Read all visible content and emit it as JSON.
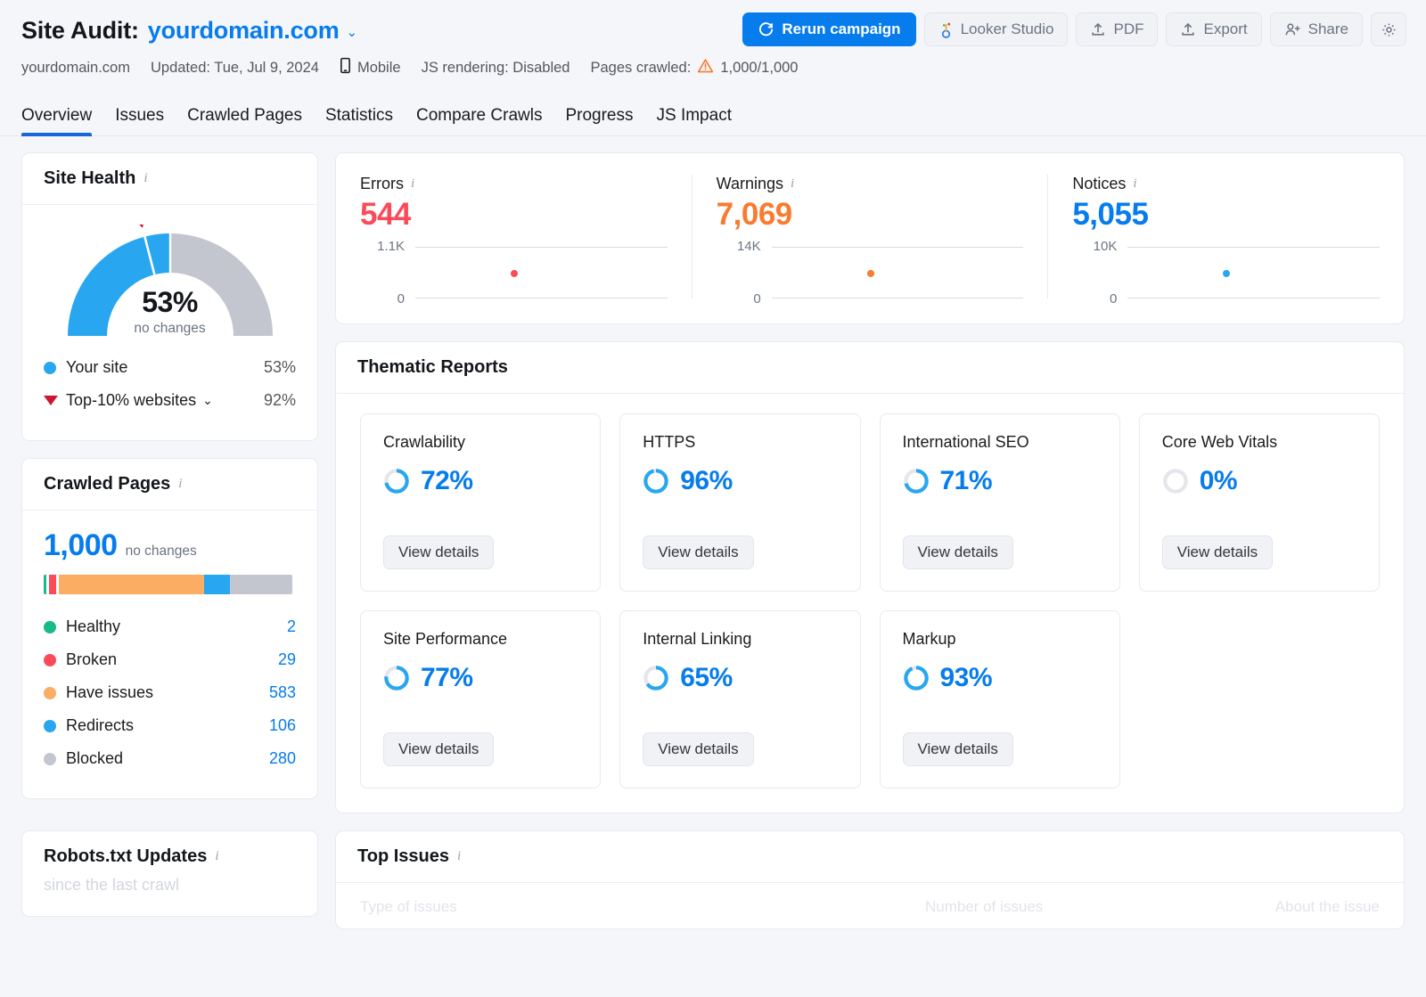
{
  "header": {
    "title_static": "Site Audit:",
    "domain": "yourdomain.com",
    "caret": "⌄",
    "meta": {
      "domain": "yourdomain.com",
      "updated": "Updated: Tue, Jul 9, 2024",
      "device": "Mobile",
      "js_rendering": "JS rendering: Disabled",
      "pages_crawled_label": "Pages crawled:",
      "pages_crawled_value": "1,000/1,000"
    },
    "actions": {
      "rerun": "Rerun campaign",
      "looker": "Looker Studio",
      "pdf": "PDF",
      "export": "Export",
      "share": "Share",
      "settings": "gear-icon"
    }
  },
  "tabs": [
    {
      "label": "Overview",
      "active": true
    },
    {
      "label": "Issues",
      "active": false
    },
    {
      "label": "Crawled Pages",
      "active": false
    },
    {
      "label": "Statistics",
      "active": false
    },
    {
      "label": "Compare Crawls",
      "active": false
    },
    {
      "label": "Progress",
      "active": false
    },
    {
      "label": "JS Impact",
      "active": false
    }
  ],
  "site_health": {
    "title": "Site Health",
    "percent": "53%",
    "delta": "no changes",
    "legend": [
      {
        "label": "Your site",
        "value": "53%",
        "color": "#28a7f0"
      },
      {
        "label": "Top-10% websites",
        "value": "92%",
        "color": "#cf1532",
        "chevron": "⌄"
      }
    ]
  },
  "crawled_pages": {
    "title": "Crawled Pages",
    "total": "1,000",
    "delta": "no changes",
    "rows": [
      {
        "label": "Healthy",
        "count": "2",
        "color": "#18ba87"
      },
      {
        "label": "Broken",
        "count": "29",
        "color": "#fa4b5a"
      },
      {
        "label": "Have issues",
        "count": "583",
        "color": "#fbae63"
      },
      {
        "label": "Redirects",
        "count": "106",
        "color": "#28a7f0"
      },
      {
        "label": "Blocked",
        "count": "280",
        "color": "#c3c6cf"
      }
    ]
  },
  "stats": [
    {
      "label": "Errors",
      "value": "544",
      "color": "#fa4b5a",
      "tick_top": "1.1K",
      "tick_bottom": "0"
    },
    {
      "label": "Warnings",
      "value": "7,069",
      "color": "#f97b2f",
      "tick_top": "14K",
      "tick_bottom": "0"
    },
    {
      "label": "Notices",
      "value": "5,055",
      "color": "#067ced",
      "tick_top": "10K",
      "tick_bottom": "0"
    }
  ],
  "thematic": {
    "title": "Thematic Reports",
    "button_label": "View details",
    "cards": [
      {
        "name": "Crawlability",
        "percent": "72%",
        "value": 72
      },
      {
        "name": "HTTPS",
        "percent": "96%",
        "value": 96
      },
      {
        "name": "International SEO",
        "percent": "71%",
        "value": 71
      },
      {
        "name": "Core Web Vitals",
        "percent": "0%",
        "value": 0
      },
      {
        "name": "Site Performance",
        "percent": "77%",
        "value": 77
      },
      {
        "name": "Internal Linking",
        "percent": "65%",
        "value": 65
      },
      {
        "name": "Markup",
        "percent": "93%",
        "value": 93
      }
    ]
  },
  "robots": {
    "title": "Robots.txt Updates",
    "subtitle": "since the last crawl"
  },
  "top_issues": {
    "title": "Top Issues",
    "col_type": "Type of issues",
    "col_number": "Number of issues",
    "col_about": "About the issue"
  },
  "chart_data": [
    {
      "type": "pie",
      "title": "Site Health",
      "subtype": "half-gauge",
      "categories": [
        "Your site",
        "Remaining"
      ],
      "values": [
        53,
        47
      ],
      "colors": [
        "#28a7f0",
        "#c3c6cf"
      ],
      "marker": {
        "label": "Top-10% websites",
        "value": 92,
        "color": "#cf1532"
      },
      "center_label": "53%",
      "center_sublabel": "no changes",
      "ylim": [
        0,
        100
      ]
    },
    {
      "type": "bar",
      "title": "Crawled Pages",
      "subtype": "stacked-horizontal",
      "categories": [
        "Healthy",
        "Broken",
        "Have issues",
        "Redirects",
        "Blocked"
      ],
      "values": [
        2,
        29,
        583,
        106,
        280
      ],
      "colors": [
        "#18ba87",
        "#fa4b5a",
        "#fbae63",
        "#28a7f0",
        "#c3c6cf"
      ],
      "total": 1000,
      "legend": "right"
    },
    {
      "type": "scatter",
      "title": "Errors",
      "values": [
        544
      ],
      "ylim": [
        0,
        1100
      ],
      "ytick_labels": [
        "0",
        "1.1K"
      ],
      "color": "#fa4b5a",
      "grid": true
    },
    {
      "type": "scatter",
      "title": "Warnings",
      "values": [
        7069
      ],
      "ylim": [
        0,
        14000
      ],
      "ytick_labels": [
        "0",
        "14K"
      ],
      "color": "#f97b2f",
      "grid": true
    },
    {
      "type": "scatter",
      "title": "Notices",
      "values": [
        5055
      ],
      "ylim": [
        0,
        10000
      ],
      "ytick_labels": [
        "0",
        "10K"
      ],
      "color": "#067ced",
      "grid": true
    },
    {
      "type": "pie",
      "title": "Thematic Reports donut scores",
      "subtype": "donut-set",
      "categories": [
        "Crawlability",
        "HTTPS",
        "International SEO",
        "Core Web Vitals",
        "Site Performance",
        "Internal Linking",
        "Markup"
      ],
      "values": [
        72,
        96,
        71,
        0,
        77,
        65,
        93
      ],
      "ylim": [
        0,
        100
      ],
      "color": "#28a7f0"
    }
  ]
}
